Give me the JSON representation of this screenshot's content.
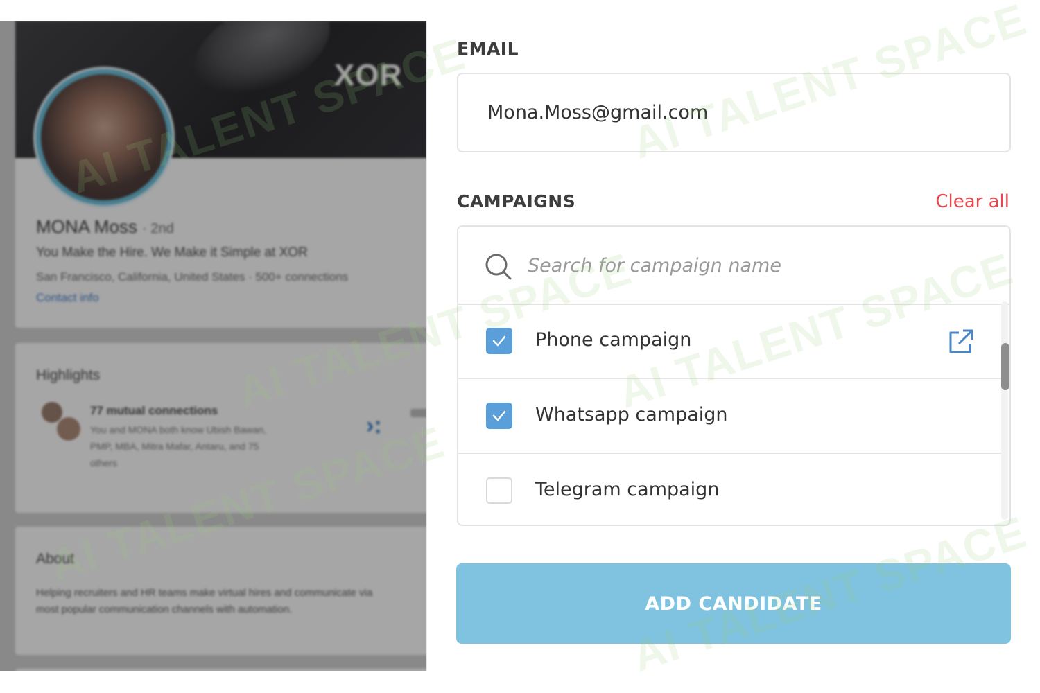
{
  "profile": {
    "brand": "XOR",
    "name": "MONA Moss",
    "degree": "2nd",
    "headline": "You Make the Hire. We Make it Simple at XOR",
    "location": "San Francisco, California, United States · 500+ connections",
    "contact_link": "Contact info",
    "highlights_title": "Highlights",
    "mutual_title": "77 mutual connections",
    "mutual_detail_1": "You and MONA both know Ubish Bawan,",
    "mutual_detail_2": "PMP, MBA, Mitra Mafar, Antaru, and 75",
    "mutual_detail_3": "others",
    "about_title": "About",
    "about_line_1": "Helping recruiters and HR teams make virtual hires and communicate via",
    "about_line_2": "most popular communication channels with automation."
  },
  "watermark": "AI TALENT SPACE",
  "form": {
    "email_label": "EMAIL",
    "email_value": "Mona.Moss@gmail.com",
    "campaigns_label": "CAMPAIGNS",
    "clear_all": "Clear all",
    "search_placeholder": "Search for campaign name",
    "campaigns": [
      {
        "name": "Phone campaign",
        "checked": true
      },
      {
        "name": "Whatsapp campaign",
        "checked": true
      },
      {
        "name": "Telegram campaign",
        "checked": false
      }
    ],
    "submit_label": "ADD CANDIDATE"
  },
  "colors": {
    "accent_red": "#e8474d",
    "checkbox_blue": "#5a9fd9",
    "button_blue": "#80c3e0",
    "icon_blue": "#4a86c5"
  }
}
